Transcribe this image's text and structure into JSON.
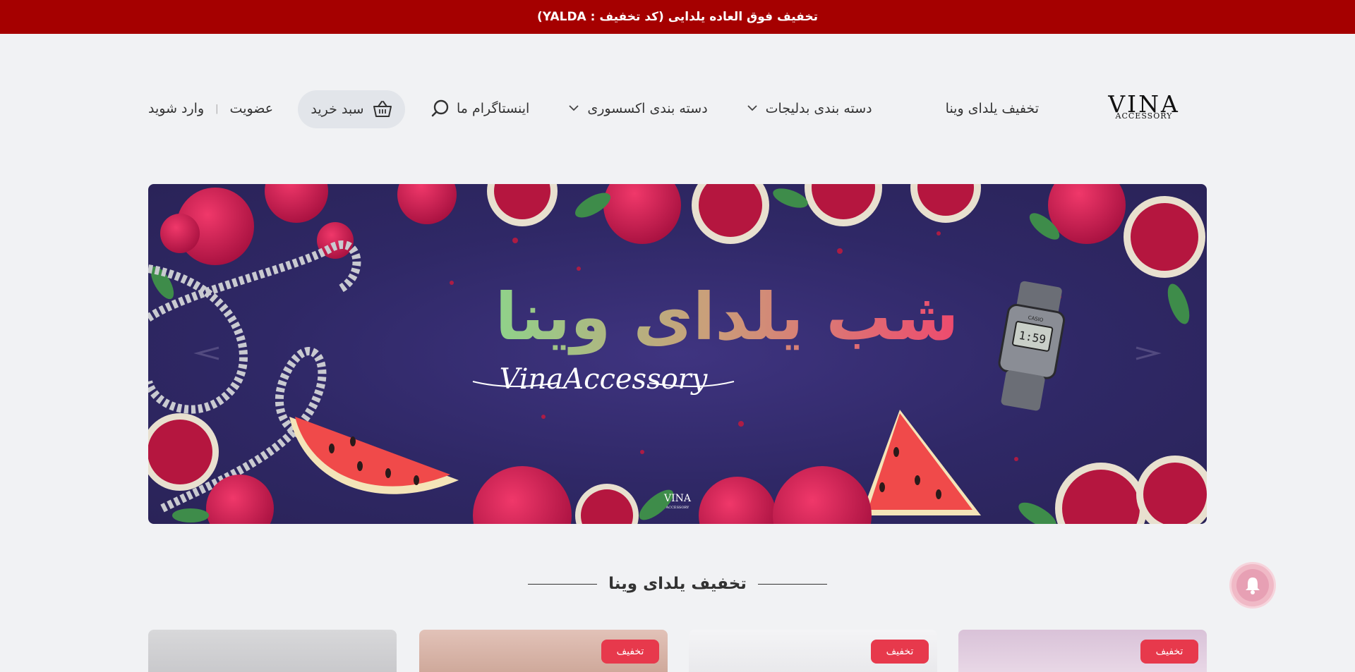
{
  "topbar": {
    "text": "تخفیف فوق العاده یلدایی (کد تخفیف : YALDA)"
  },
  "logo": {
    "name": "VINA",
    "sub": "ACCESSORY"
  },
  "nav": {
    "items": [
      {
        "label": "تخفیف یلدای وینا",
        "has_dropdown": false
      },
      {
        "label": "دسته بندی بدلیجات",
        "has_dropdown": true
      },
      {
        "label": "دسته بندی اکسسوری",
        "has_dropdown": true
      },
      {
        "label": "اینستاگرام ما",
        "has_dropdown": false
      }
    ]
  },
  "search": {
    "icon": "search-icon"
  },
  "cart": {
    "label": "سبد خرید",
    "icon": "basket-icon"
  },
  "auth": {
    "signup": "عضویت",
    "login": "وارد شوید"
  },
  "banner": {
    "title": "شب یلدای وینا",
    "brand_script": "VinaAccessory",
    "logo": "VINA",
    "logo_sub": "ACCESSORY",
    "watch_time": "1:59",
    "watch_brand": "CASIO"
  },
  "section": {
    "title": "تخفیف یلدای وینا"
  },
  "products": {
    "badge": "تخفیف"
  },
  "colors": {
    "topbar": "#a50000",
    "accent": "#e7394c",
    "banner_bg": "#2f2866"
  }
}
